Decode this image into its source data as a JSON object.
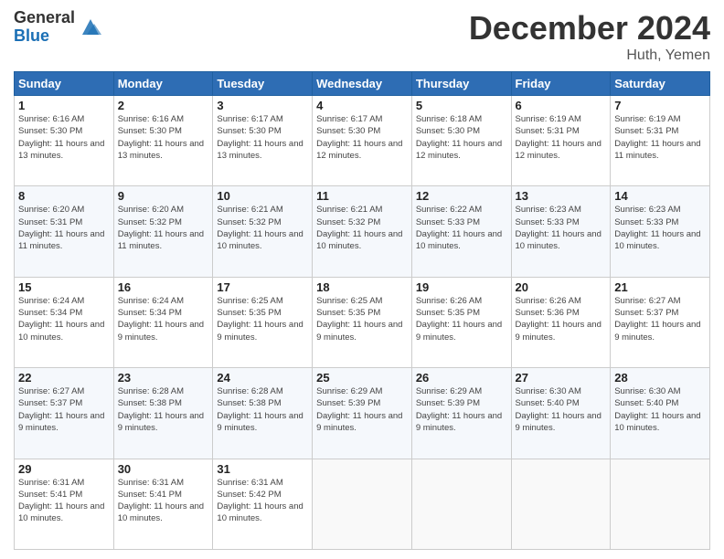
{
  "logo": {
    "general": "General",
    "blue": "Blue"
  },
  "title": "December 2024",
  "location": "Huth, Yemen",
  "days_header": [
    "Sunday",
    "Monday",
    "Tuesday",
    "Wednesday",
    "Thursday",
    "Friday",
    "Saturday"
  ],
  "weeks": [
    [
      {
        "day": "1",
        "sunrise": "6:16 AM",
        "sunset": "5:30 PM",
        "daylight": "11 hours and 13 minutes."
      },
      {
        "day": "2",
        "sunrise": "6:16 AM",
        "sunset": "5:30 PM",
        "daylight": "11 hours and 13 minutes."
      },
      {
        "day": "3",
        "sunrise": "6:17 AM",
        "sunset": "5:30 PM",
        "daylight": "11 hours and 13 minutes."
      },
      {
        "day": "4",
        "sunrise": "6:17 AM",
        "sunset": "5:30 PM",
        "daylight": "11 hours and 12 minutes."
      },
      {
        "day": "5",
        "sunrise": "6:18 AM",
        "sunset": "5:30 PM",
        "daylight": "11 hours and 12 minutes."
      },
      {
        "day": "6",
        "sunrise": "6:19 AM",
        "sunset": "5:31 PM",
        "daylight": "11 hours and 12 minutes."
      },
      {
        "day": "7",
        "sunrise": "6:19 AM",
        "sunset": "5:31 PM",
        "daylight": "11 hours and 11 minutes."
      }
    ],
    [
      {
        "day": "8",
        "sunrise": "6:20 AM",
        "sunset": "5:31 PM",
        "daylight": "11 hours and 11 minutes."
      },
      {
        "day": "9",
        "sunrise": "6:20 AM",
        "sunset": "5:32 PM",
        "daylight": "11 hours and 11 minutes."
      },
      {
        "day": "10",
        "sunrise": "6:21 AM",
        "sunset": "5:32 PM",
        "daylight": "11 hours and 10 minutes."
      },
      {
        "day": "11",
        "sunrise": "6:21 AM",
        "sunset": "5:32 PM",
        "daylight": "11 hours and 10 minutes."
      },
      {
        "day": "12",
        "sunrise": "6:22 AM",
        "sunset": "5:33 PM",
        "daylight": "11 hours and 10 minutes."
      },
      {
        "day": "13",
        "sunrise": "6:23 AM",
        "sunset": "5:33 PM",
        "daylight": "11 hours and 10 minutes."
      },
      {
        "day": "14",
        "sunrise": "6:23 AM",
        "sunset": "5:33 PM",
        "daylight": "11 hours and 10 minutes."
      }
    ],
    [
      {
        "day": "15",
        "sunrise": "6:24 AM",
        "sunset": "5:34 PM",
        "daylight": "11 hours and 10 minutes."
      },
      {
        "day": "16",
        "sunrise": "6:24 AM",
        "sunset": "5:34 PM",
        "daylight": "11 hours and 9 minutes."
      },
      {
        "day": "17",
        "sunrise": "6:25 AM",
        "sunset": "5:35 PM",
        "daylight": "11 hours and 9 minutes."
      },
      {
        "day": "18",
        "sunrise": "6:25 AM",
        "sunset": "5:35 PM",
        "daylight": "11 hours and 9 minutes."
      },
      {
        "day": "19",
        "sunrise": "6:26 AM",
        "sunset": "5:35 PM",
        "daylight": "11 hours and 9 minutes."
      },
      {
        "day": "20",
        "sunrise": "6:26 AM",
        "sunset": "5:36 PM",
        "daylight": "11 hours and 9 minutes."
      },
      {
        "day": "21",
        "sunrise": "6:27 AM",
        "sunset": "5:37 PM",
        "daylight": "11 hours and 9 minutes."
      }
    ],
    [
      {
        "day": "22",
        "sunrise": "6:27 AM",
        "sunset": "5:37 PM",
        "daylight": "11 hours and 9 minutes."
      },
      {
        "day": "23",
        "sunrise": "6:28 AM",
        "sunset": "5:38 PM",
        "daylight": "11 hours and 9 minutes."
      },
      {
        "day": "24",
        "sunrise": "6:28 AM",
        "sunset": "5:38 PM",
        "daylight": "11 hours and 9 minutes."
      },
      {
        "day": "25",
        "sunrise": "6:29 AM",
        "sunset": "5:39 PM",
        "daylight": "11 hours and 9 minutes."
      },
      {
        "day": "26",
        "sunrise": "6:29 AM",
        "sunset": "5:39 PM",
        "daylight": "11 hours and 9 minutes."
      },
      {
        "day": "27",
        "sunrise": "6:30 AM",
        "sunset": "5:40 PM",
        "daylight": "11 hours and 9 minutes."
      },
      {
        "day": "28",
        "sunrise": "6:30 AM",
        "sunset": "5:40 PM",
        "daylight": "11 hours and 10 minutes."
      }
    ],
    [
      {
        "day": "29",
        "sunrise": "6:31 AM",
        "sunset": "5:41 PM",
        "daylight": "11 hours and 10 minutes."
      },
      {
        "day": "30",
        "sunrise": "6:31 AM",
        "sunset": "5:41 PM",
        "daylight": "11 hours and 10 minutes."
      },
      {
        "day": "31",
        "sunrise": "6:31 AM",
        "sunset": "5:42 PM",
        "daylight": "11 hours and 10 minutes."
      },
      null,
      null,
      null,
      null
    ]
  ]
}
